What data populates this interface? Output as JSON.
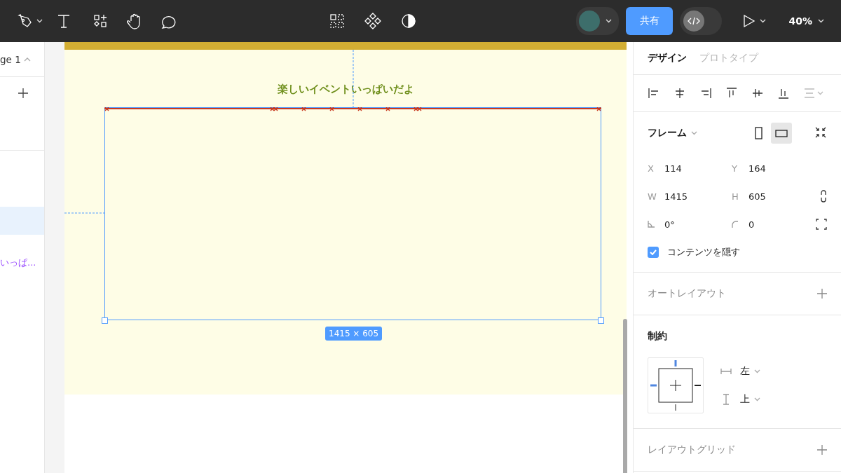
{
  "toolbar": {
    "share_button": "共有",
    "dev_mode": {
      "on": false
    },
    "zoom": "40%"
  },
  "pages_panel": {
    "page": "ge 1",
    "expanded": true
  },
  "layers": [
    {
      "selected": true
    },
    {
      "label": "いっぱ...",
      "selected": false
    }
  ],
  "canvas": {
    "heading": "楽しいイベントいっぱいだよ",
    "selection_size": "1415 × 605"
  },
  "properties": {
    "tabs": [
      {
        "label": "デザイン",
        "selected": true
      },
      {
        "label": "プロトタイプ",
        "selected": false
      }
    ],
    "frame": {
      "title": "フレーム",
      "orientation": [
        {
          "kind": "portrait",
          "selected": false
        },
        {
          "kind": "landscape",
          "selected": true
        }
      ],
      "fields": [
        {
          "label": "X",
          "value": "114"
        },
        {
          "label": "Y",
          "value": "164"
        },
        {
          "label": "W",
          "value": "1415"
        },
        {
          "label": "H",
          "value": "605"
        },
        {
          "kind": "rotation",
          "value": "0°"
        },
        {
          "kind": "radius",
          "value": "0"
        }
      ],
      "clip_content": {
        "label": "コンテンツを隠す",
        "checked": true
      }
    },
    "auto_layout": "オートレイアウト",
    "constraints": {
      "title": "制約",
      "horizontal": "左",
      "vertical": "上"
    },
    "layout_grid": "レイアウトグリッド"
  }
}
